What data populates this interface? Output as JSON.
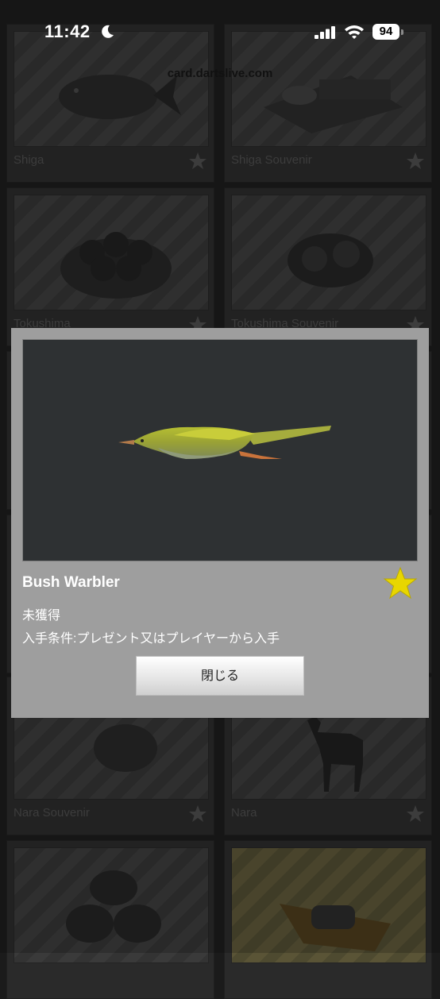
{
  "status_bar": {
    "time": "11:42",
    "battery": "94",
    "icons": [
      "moon-icon",
      "signal-icon",
      "wifi-icon",
      "battery-icon"
    ]
  },
  "browser": {
    "url": "card.dartslive.com"
  },
  "grid": {
    "cards": [
      {
        "label": "Shiga",
        "icon": "fish",
        "star": "star-icon"
      },
      {
        "label": "Shiga Souvenir",
        "icon": "food-tray",
        "star": "star-icon"
      },
      {
        "label": "Tokushima",
        "icon": "fruit-basket",
        "star": "star-icon"
      },
      {
        "label": "Tokushima Souvenir",
        "icon": "citrus-bowl",
        "star": "star-icon"
      },
      {
        "label": "Nara Souvenir",
        "icon": "round-cake",
        "star": "star-icon"
      },
      {
        "label": "Nara",
        "icon": "deer",
        "star": "star-icon"
      },
      {
        "label": "",
        "icon": "rice-bales"
      },
      {
        "label": "",
        "icon": "sushi-boat"
      }
    ]
  },
  "modal": {
    "title": "Bush Warbler",
    "status": "未獲得",
    "condition": "入手条件:プレゼント又はプレイヤーから入手",
    "close_label": "閉じる",
    "image_icon": "bush-warbler-bird",
    "star_color": "#e8d600"
  }
}
